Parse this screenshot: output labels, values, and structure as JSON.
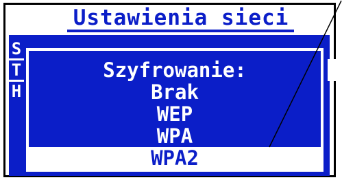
{
  "header": {
    "title": "Ustawienia sieci"
  },
  "side_tabs": [
    "S",
    "T",
    "H"
  ],
  "dialog": {
    "heading": "Szyfrowanie:",
    "options": [
      "Brak",
      "WEP",
      "WPA",
      "WPA2"
    ],
    "selected": "WPA2"
  },
  "colors": {
    "lcd_blue": "#0b1ec8",
    "lcd_white": "#ffffff",
    "frame": "#000000"
  }
}
